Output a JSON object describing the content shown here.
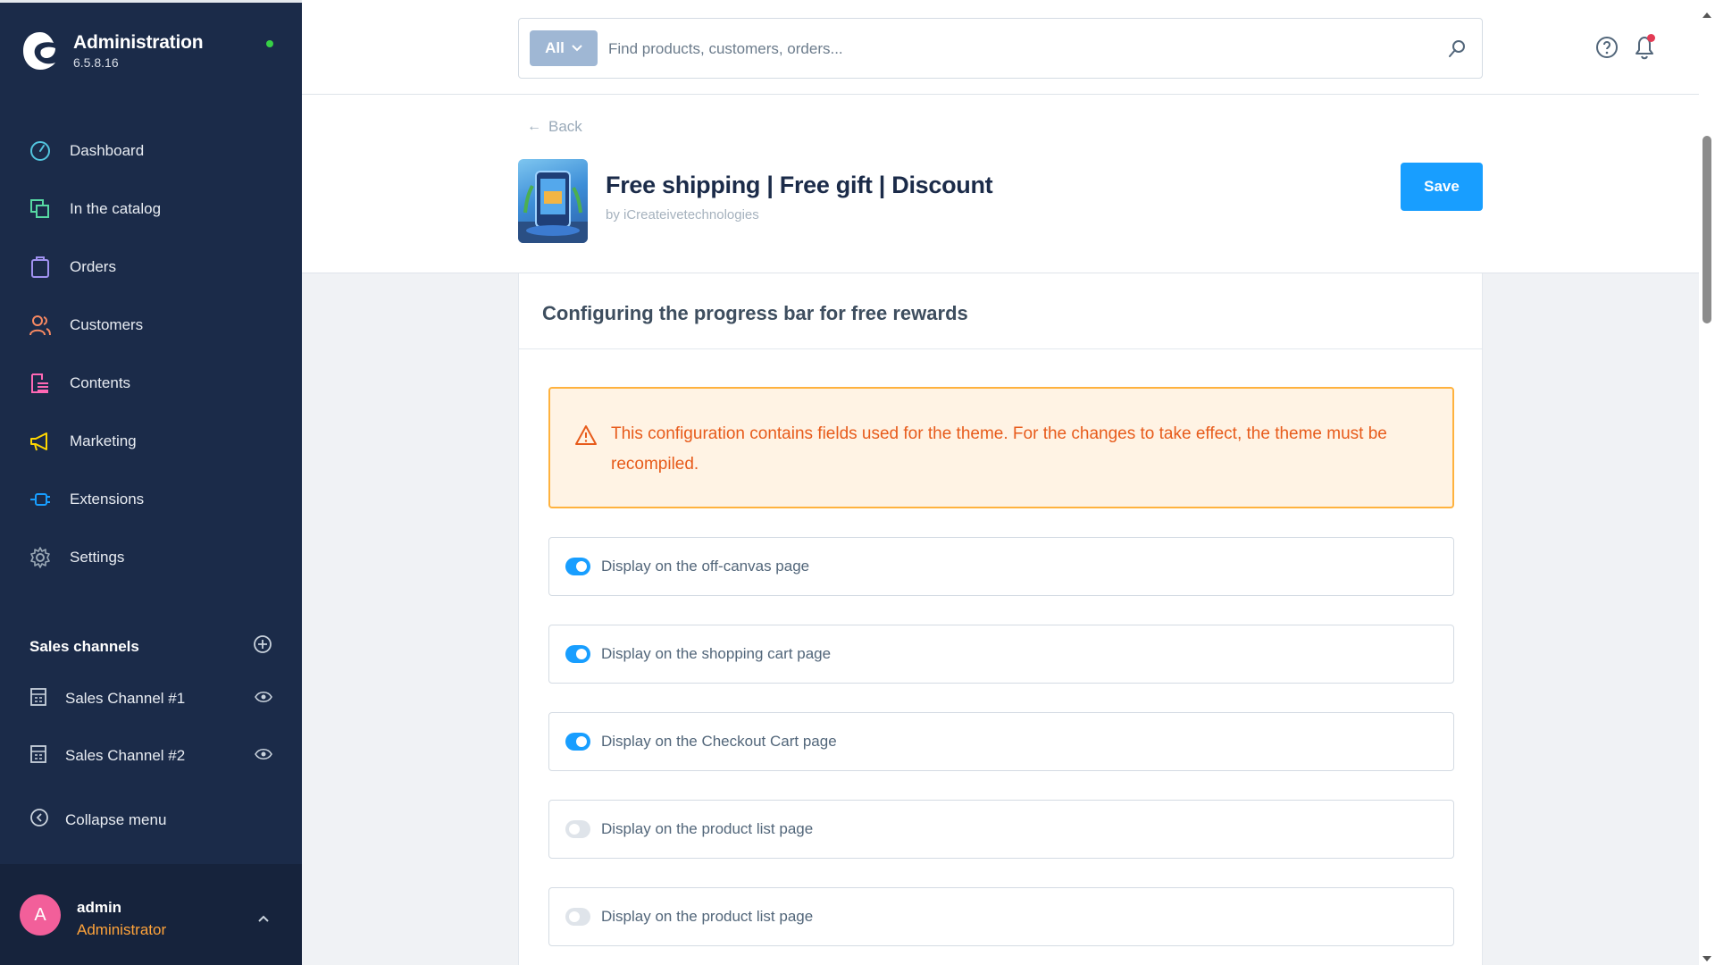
{
  "app": {
    "title": "Administration",
    "version": "6.5.8.16"
  },
  "nav": {
    "items": [
      {
        "label": "Dashboard",
        "icon": "dashboard-icon",
        "color": "#52c4de"
      },
      {
        "label": "In the catalog",
        "icon": "catalog-icon",
        "color": "#57d9a3"
      },
      {
        "label": "Orders",
        "icon": "orders-icon",
        "color": "#a092f0"
      },
      {
        "label": "Customers",
        "icon": "customers-icon",
        "color": "#f88962"
      },
      {
        "label": "Contents",
        "icon": "contents-icon",
        "color": "#ff68b4"
      },
      {
        "label": "Marketing",
        "icon": "marketing-icon",
        "color": "#ffd700"
      },
      {
        "label": "Extensions",
        "icon": "extensions-icon",
        "color": "#189eff"
      },
      {
        "label": "Settings",
        "icon": "settings-icon",
        "color": "#9aa8b5"
      }
    ]
  },
  "sales_channels": {
    "title": "Sales channels",
    "items": [
      {
        "label": "Sales Channel #1"
      },
      {
        "label": "Sales Channel #2"
      }
    ]
  },
  "collapse": {
    "label": "Collapse menu"
  },
  "user": {
    "initial": "A",
    "name": "admin",
    "role": "Administrator"
  },
  "search": {
    "type_label": "All",
    "placeholder": "Find products, customers, orders..."
  },
  "smartbar": {
    "back_label": "Back",
    "title": "Free shipping | Free gift | Discount",
    "subtitle": "by iCreateivetechnologies",
    "save_label": "Save"
  },
  "card": {
    "title": "Configuring the progress bar for free rewards",
    "alert": "This configuration contains fields used for the theme. For the changes to take effect, the theme must be recompiled.",
    "toggles": [
      {
        "label": "Display on the off-canvas page",
        "on": true
      },
      {
        "label": "Display on the shopping cart page",
        "on": true
      },
      {
        "label": "Display on the Checkout Cart page",
        "on": true
      },
      {
        "label": "Display on the product list page",
        "on": false
      },
      {
        "label": "Display on the product list page",
        "on": false
      }
    ]
  },
  "colors": {
    "sidebar": "#1b2b49",
    "primary": "#189eff",
    "warning_border": "#ffb23e",
    "warning_text": "#e75b1b",
    "role": "#ffa33a",
    "avatar": "#f25f9a",
    "online": "#37d046"
  }
}
